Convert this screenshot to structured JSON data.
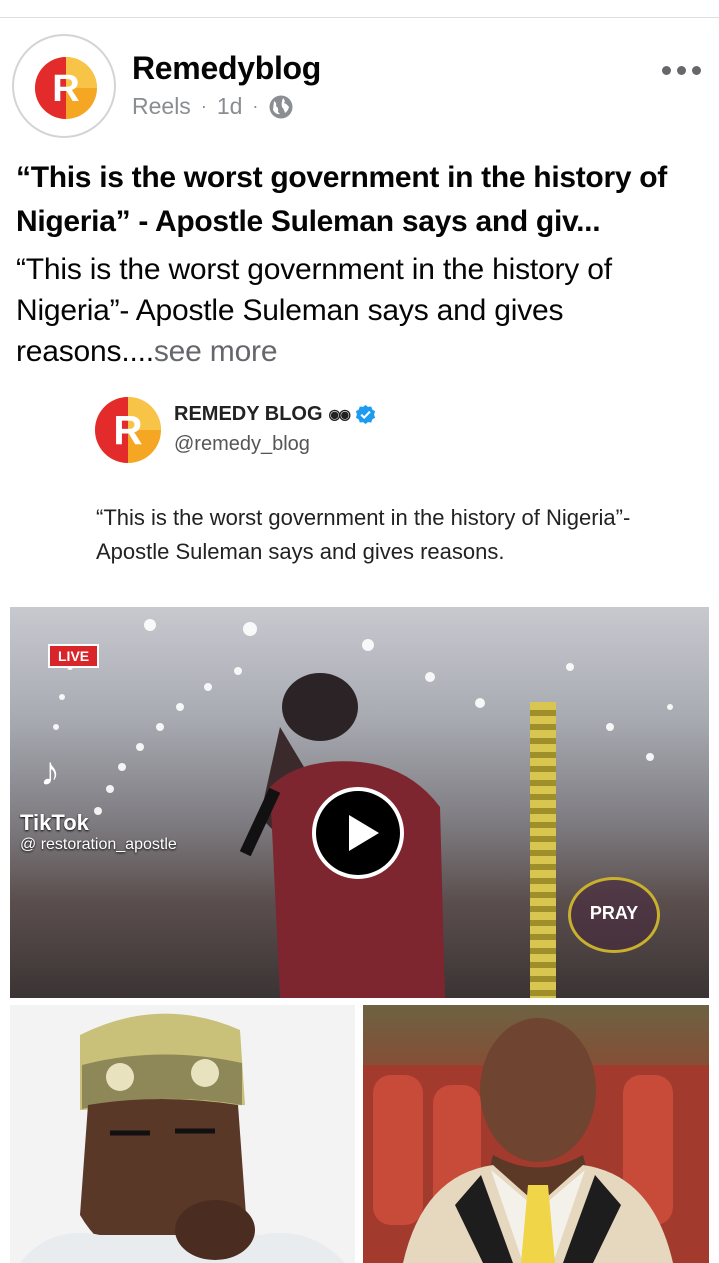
{
  "post": {
    "page_name": "Remedyblog",
    "meta": {
      "type": "Reels",
      "separator": "·",
      "age": "1d"
    },
    "headline": "“This is the worst government in the history of Nigeria” - Apostle Suleman says and giv...",
    "body": "“This is the worst government in the history of Nigeria”- Apostle Suleman says and gives reasons....",
    "see_more": "see more"
  },
  "tweet": {
    "name": "REMEDY BLOG",
    "handle": "@remedy_blog",
    "text": "“This is the worst government in the history of Nigeria”- Apostle Suleman says and gives reasons."
  },
  "video": {
    "live_badge": "LIVE",
    "tiktok_label": "TikTok",
    "tiktok_user": "@ restoration_apostle",
    "overlay_logo_text": "PRAY"
  },
  "icons": {
    "globe": "globe-icon",
    "more": "more-options-icon",
    "verified": "verified-badge-icon",
    "play": "play-icon"
  },
  "colors": {
    "brand_red": "#e32b2b",
    "brand_orange": "#f5a623",
    "meta_gray": "#8a8d91",
    "verified_blue": "#1d9bf0"
  }
}
